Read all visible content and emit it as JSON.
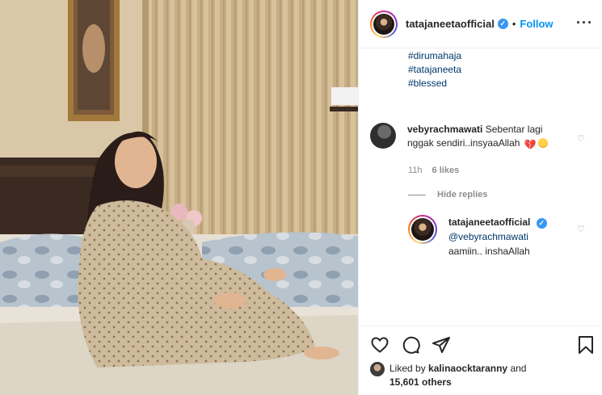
{
  "post": {
    "username": "tatajaneetaofficial",
    "follow_label": "Follow",
    "separator": "•",
    "verified_icon": "verified-badge-icon",
    "more_icon": "more-options-icon"
  },
  "caption": {
    "hashtags": [
      "#dirumahaja",
      "#tatajaneeta",
      "#blessed"
    ]
  },
  "comment": {
    "username": "vebyrachmawati",
    "text": "Sebentar lagi nggak sendiri..insyaaAllah",
    "emojis": [
      "broken-heart-emoji",
      "heart-eyes-emoji"
    ],
    "time": "11h",
    "likes": "6 likes"
  },
  "replies_toggle": {
    "label": "Hide replies"
  },
  "reply": {
    "username": "tatajaneetaofficial",
    "mention": "@vebyrachmawati",
    "text": "aamiin.. inshaAllah"
  },
  "likes": {
    "prefix": "Liked by",
    "user": "kalinaocktaranny",
    "and": "and",
    "others": "15,601 others"
  },
  "colors": {
    "link": "#00376b",
    "follow": "#0095f6",
    "verified": "#3897f0",
    "muted": "#8e8e8e"
  }
}
